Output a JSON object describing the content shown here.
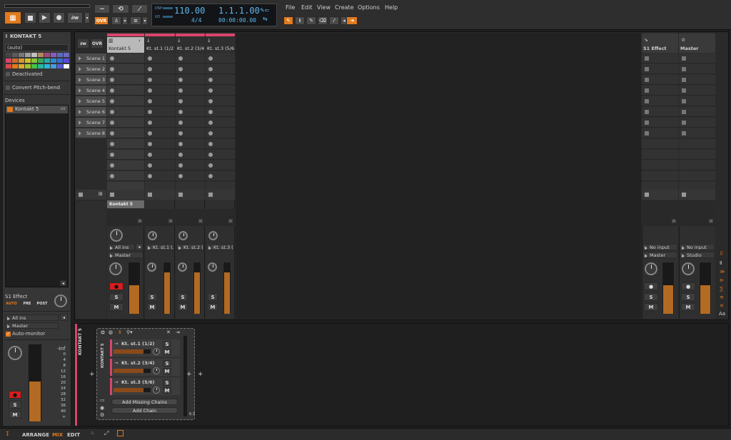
{
  "transport": {
    "bpm": "110.00",
    "position": "1.1.1.00",
    "signature": "4/4",
    "time": "00:00:00.00",
    "disp": "DSP",
    "io": "I/O",
    "ovr": "OVR"
  },
  "menu": [
    "File",
    "Edit",
    "View",
    "Create",
    "Options",
    "Help"
  ],
  "inspector": {
    "track_name": "KONTAKT 5",
    "auto": "(auto)",
    "deactivated": "Deactivated",
    "convert": "Convert Pitch-bend",
    "devices_label": "Devices",
    "device": "Kontakt 5",
    "send_label": "S1 Effect",
    "auto_btn": "AUTO",
    "pre_btn": "PRE",
    "post_btn": "POST",
    "input": "All ins",
    "output": "Master",
    "auto_monitor": "Auto-monitor",
    "peak": "-Inf",
    "scale": [
      "0",
      "4",
      "8",
      "12",
      "16",
      "20",
      "24",
      "28",
      "32",
      "36",
      "40",
      "∞"
    ],
    "solo": "S",
    "mute": "M"
  },
  "clip_launcher": {
    "ovr": "OVR",
    "scenes": [
      "Scene 1",
      "Scene 2",
      "Scene 3",
      "Scene 4",
      "Scene 5",
      "Scene 6",
      "Scene 7",
      "Scene 8"
    ]
  },
  "tracks": [
    {
      "name": "Kontakt 5",
      "input": "All ins",
      "output": "Master",
      "device": "Kontakt 5"
    },
    {
      "name": "Kt. st.1 (1/2)",
      "input": "Kt. st.1 (...",
      "output": ""
    },
    {
      "name": "Kt. st.2 (3/4)",
      "input": "Kt. st.2 (...",
      "output": ""
    },
    {
      "name": "Kt. st.3 (5/6)",
      "input": "Kt. st.3 (...",
      "output": ""
    }
  ],
  "fx_tracks": [
    {
      "name": "S1 Effect",
      "input": "No input",
      "output": "Master"
    },
    {
      "name": "Master",
      "input": "No input",
      "output": "Studio"
    }
  ],
  "device_panel": {
    "track": "KONTAKT 5",
    "device": "KONTAKT 5",
    "chains": [
      "Kt. st.1 (1/2)",
      "Kt. st.2 (3/4)",
      "Kt. st.3 (5/6)"
    ],
    "add_missing": "Add Missing Chains",
    "add_chain": "Add Chain",
    "peak": "6.3"
  },
  "bottom_tabs": {
    "arrange": "ARRANGE",
    "mix": "MIX",
    "edit": "EDIT"
  },
  "colors": {
    "accent": "#e07a1f",
    "track": "#d8456c",
    "lcd": "#5fb8e8"
  }
}
